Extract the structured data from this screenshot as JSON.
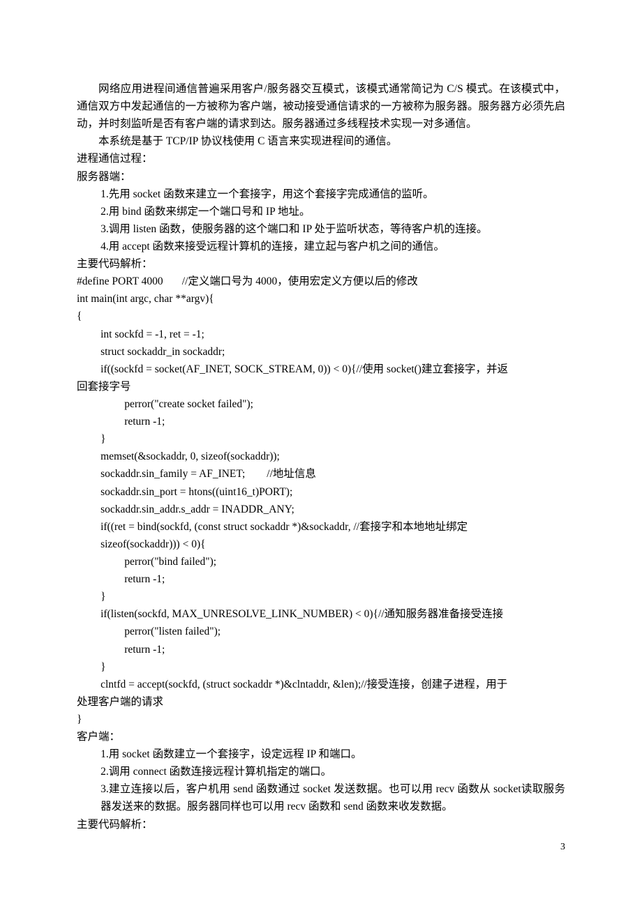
{
  "p1": "网络应用进程间通信普遍采用客户/服务器交互模式，该模式通常简记为 C/S 模式。在该模式中，通信双方中发起通信的一方被称为客户端，被动接受通信请求的一方被称为服务器。服务器方必须先启动，并时刻监听是否有客户端的请求到达。服务器通过多线程技术实现一对多通信。",
  "p2": "本系统是基于 TCP/IP 协议栈使用 C 语言来实现进程间的通信。",
  "p3": "进程通信过程：",
  "p4": "服务器端：",
  "s1": "1.先用 socket 函数来建立一个套接字，用这个套接字完成通信的监听。",
  "s2": "2.用 bind 函数来绑定一个端口号和 IP 地址。",
  "s3": "3.调用 listen 函数，使服务器的这个端口和 IP 处于监听状态，等待客户机的连接。",
  "s4": "4.用 accept 函数来接受远程计算机的连接，建立起与客户机之间的通信。",
  "p5": "主要代码解析：",
  "c01": "#define PORT 4000       //定义端口号为 4000，使用宏定义方便以后的修改",
  "c02": "int main(int argc, char **argv){",
  "c03": "{",
  "c04": "int sockfd = -1, ret = -1;",
  "c05": "struct sockaddr_in sockaddr;",
  "c06": "if((sockfd = socket(AF_INET, SOCK_STREAM, 0)) < 0){//使用 socket()建立套接字，并返",
  "c06b": "回套接字号",
  "c07": "perror(\"create socket failed\");",
  "c08": "return -1;",
  "c09": "}",
  "c10": "memset(&sockaddr, 0, sizeof(sockaddr));",
  "c11": "sockaddr.sin_family = AF_INET;        //地址信息",
  "c12": "sockaddr.sin_port = htons((uint16_t)PORT);",
  "c13": "sockaddr.sin_addr.s_addr = INADDR_ANY;",
  "c14": "if((ret = bind(sockfd, (const struct sockaddr *)&sockaddr, //套接字和本地地址绑定",
  "c15": "sizeof(sockaddr))) < 0){",
  "c16": "perror(\"bind failed\");",
  "c17": "return -1;",
  "c18": "}",
  "c19": "if(listen(sockfd, MAX_UNRESOLVE_LINK_NUMBER) < 0){//通知服务器准备接受连接",
  "c20": "perror(\"listen failed\");",
  "c21": "return -1;",
  "c22": "}",
  "c23": "clntfd = accept(sockfd, (struct sockaddr *)&clntaddr, &len);//接受连接，创建子进程，用于",
  "c23b": "处理客户端的请求",
  "c24": "}",
  "p6": "客户端：",
  "cl1": "1.用 socket 函数建立一个套接字，设定远程 IP 和端口。",
  "cl2": "2.调用 connect 函数连接远程计算机指定的端口。",
  "cl3": "3.建立连接以后，客户机用 send 函数通过 socket 发送数据。也可以用 recv 函数从 socket读取服务器发送来的数据。服务器同样也可以用 recv 函数和 send 函数来收发数据。",
  "p7": "主要代码解析：",
  "pageNum": "3"
}
